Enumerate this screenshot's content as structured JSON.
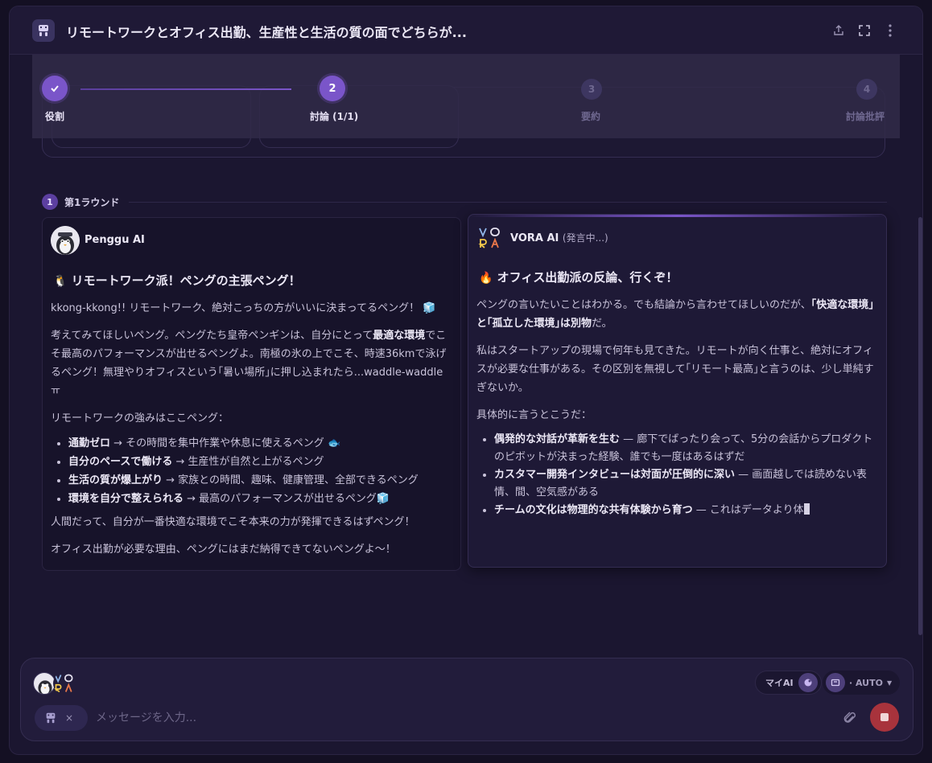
{
  "header": {
    "title": "リモートワークとオフィス出勤、生産性と生活の質の面でどちらが...",
    "icons": [
      "share-icon",
      "expand-icon",
      "more-icon"
    ]
  },
  "stepper": {
    "steps": [
      {
        "label": "役割",
        "marker": "✓",
        "state": "done"
      },
      {
        "label": "討論 (1/1)",
        "marker": "2",
        "state": "active"
      },
      {
        "label": "要約",
        "marker": "3",
        "state": "idle"
      },
      {
        "label": "討論批評",
        "marker": "4",
        "state": "idle"
      }
    ]
  },
  "round": {
    "number": "1",
    "label": "第1ラウンド"
  },
  "penggu": {
    "name": "Penggu AI",
    "title": "リモートワーク派！ペングの主張ペング！",
    "p1": "kkong-kkong!! リモートワーク、絶対こっちの方がいいに決まってるペング！",
    "p2_a": "考えてみてほしいペング。ペングたち皇帝ペンギンは、自分にとって",
    "p2_b": "最適な環境",
    "p2_c": "でこそ最高のパフォーマンスが出せるペングよ。南極の氷の上でこそ、時速36kmで泳げるペング！無理やりオフィスという｢暑い場所｣に押し込まれたら...waddle-waddle ㅠ",
    "p3": "リモートワークの強みはここペング：",
    "bullets": [
      {
        "bold": "通勤ゼロ",
        "text": " → その時間を集中作業や休息に使えるペング"
      },
      {
        "bold": "自分のペースで働ける",
        "text": " → 生産性が自然と上がるペング"
      },
      {
        "bold": "生活の質が爆上がり",
        "text": " → 家族との時間、趣味、健康管理、全部できるペング"
      },
      {
        "bold": "環境を自分で整えられる",
        "text": " → 最高のパフォーマンスが出せるペング"
      }
    ],
    "p4": "人間だって、自分が一番快適な環境でこそ本来の力が発揮できるはずペング！",
    "p5": "オフィス出勤が必要な理由、ペングにはまだ納得できてないペングよ～！"
  },
  "vora": {
    "name": "VORA AI",
    "status": "(発言中...)",
    "title": "オフィス出勤派の反論、行くぞ！",
    "p1_a": "ペングの言いたいことはわかる。でも結論から言わせてほしいのだが、",
    "p1_b": "｢快適な環境｣と｢孤立した環境｣は別物",
    "p1_c": "だ。",
    "p2": "私はスタートアップの現場で何年も見てきた。リモートが向く仕事と、絶対にオフィスが必要な仕事がある。その区別を無視して｢リモート最高｣と言うのは、少し単純すぎないか。",
    "p3": "具体的に言うとこうだ：",
    "bullets": [
      {
        "bold": "偶発的な対話が革新を生む",
        "text": " — 廊下でばったり会って、5分の会話からプロダクトのピボットが決まった経験、誰でも一度はあるはずだ"
      },
      {
        "bold": "カスタマー開発インタビューは対面が圧倒的に深い",
        "text": " — 画面越しでは読めない表情、間、空気感がある"
      },
      {
        "bold": "チームの文化は物理的な共有体験から育つ",
        "text": " — これはデータより体"
      }
    ]
  },
  "composer": {
    "my_ai_label": "マイAI",
    "auto_label": "· AUTO",
    "placeholder": "メッセージを入力...",
    "tag_close": "×"
  },
  "colors": {
    "accent": "#7a55c9",
    "stop": "#a8333c",
    "background": "#1b1630"
  }
}
